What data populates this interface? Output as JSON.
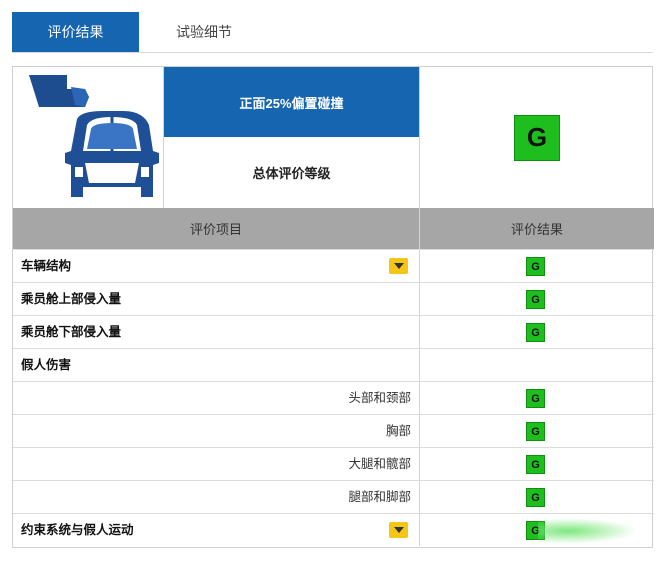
{
  "tabs": [
    {
      "label": "评价结果",
      "active": true
    },
    {
      "label": "试验细节",
      "active": false
    }
  ],
  "header": {
    "test_name": "正面25%偏置碰撞",
    "overall_label": "总体评价等级",
    "overall_rating": "G",
    "icon": "car-small-overlap-icon"
  },
  "table": {
    "col_item": "评价项目",
    "col_result": "评价结果",
    "rows": [
      {
        "label": "车辆结构",
        "rating": "G",
        "expandable": true,
        "sub": false
      },
      {
        "label": "乘员舱上部侵入量",
        "rating": "G",
        "expandable": false,
        "sub": false
      },
      {
        "label": "乘员舱下部侵入量",
        "rating": "G",
        "expandable": false,
        "sub": false
      },
      {
        "label": "假人伤害",
        "rating": "",
        "expandable": false,
        "sub": false
      },
      {
        "label": "头部和颈部",
        "rating": "G",
        "expandable": false,
        "sub": true
      },
      {
        "label": "胸部",
        "rating": "G",
        "expandable": false,
        "sub": true
      },
      {
        "label": "大腿和髋部",
        "rating": "G",
        "expandable": false,
        "sub": true
      },
      {
        "label": "腿部和脚部",
        "rating": "G",
        "expandable": false,
        "sub": true
      },
      {
        "label": "约束系统与假人运动",
        "rating": "G",
        "expandable": true,
        "sub": false
      }
    ]
  },
  "colors": {
    "accent": "#1565b0",
    "good": "#1fbe1f",
    "header_gray": "#a6a6a6",
    "dropdown": "#f5c518"
  }
}
